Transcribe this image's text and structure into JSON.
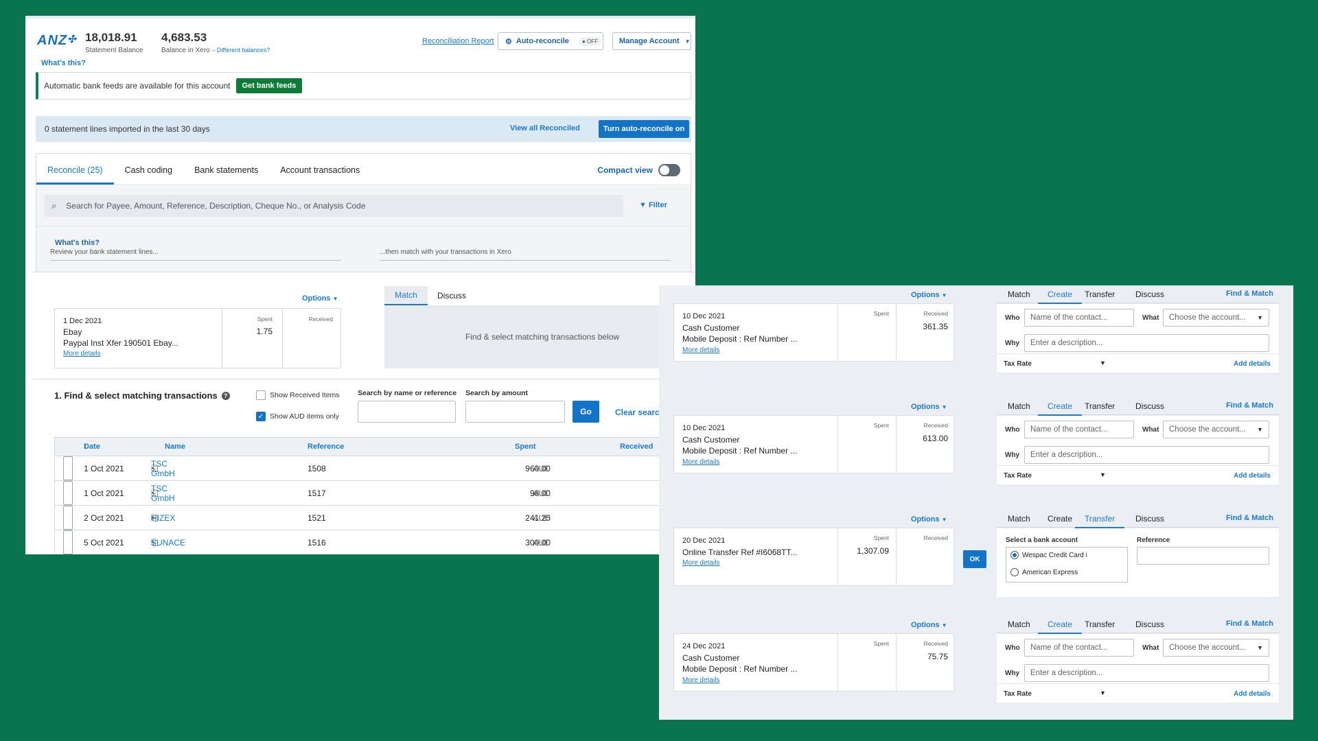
{
  "header": {
    "bank_logo": "ANZ",
    "statement_balance": "18,018.91",
    "statement_balance_label": "Statement Balance",
    "xero_balance": "4,683.53",
    "xero_balance_label": "Balance in Xero",
    "different_balances": "– Different balances?",
    "whats_this": "What's this?",
    "reconciliation_report": "Reconciliation Report",
    "auto_reconcile": "Auto-reconcile",
    "auto_reconcile_state": "OFF",
    "manage_account": "Manage Account"
  },
  "feeds_banner": {
    "text": "Automatic bank feeds are available for this account",
    "button": "Get bank feeds"
  },
  "statement_bar": {
    "text": "0 statement lines imported in the last 30 days",
    "view_all": "View all Reconciled",
    "turn_on": "Turn auto-reconcile on"
  },
  "tabs": [
    "Reconcile (25)",
    "Cash coding",
    "Bank statements",
    "Account transactions"
  ],
  "compact_view": "Compact view",
  "search": {
    "placeholder": "Search for Payee, Amount, Reference, Description, Cheque No., or Analysis Code",
    "filter": "Filter"
  },
  "help": {
    "title": "What's this?",
    "left": "Review your bank statement lines...",
    "right": "...then match with your transactions in Xero"
  },
  "left_tx": {
    "options": "Options",
    "date": "1 Dec 2021",
    "payee": "Ebay",
    "description": "Paypal Inst Xfer 190501 Ebay...",
    "more": "More details",
    "spent_label": "Spent",
    "spent": "1.75",
    "received_label": "Received",
    "match_tab": "Match",
    "discuss_tab": "Discuss",
    "match_hint": "Find & select matching transactions below"
  },
  "find": {
    "title": "1. Find & select matching transactions",
    "show_received": "Show Received Items",
    "show_aud": "Show AUD items only",
    "search_name_label": "Search by name or reference",
    "search_amount_label": "Search by amount",
    "go": "Go",
    "clear": "Clear search"
  },
  "table": {
    "columns": [
      "Date",
      "Name",
      "Reference",
      "Spent",
      "Received"
    ],
    "rows": [
      {
        "date": "1 Oct 2021",
        "name": "TSC GmbH",
        "reference": "1508",
        "spent": "960.00",
        "currency": "AUD"
      },
      {
        "date": "1 Oct 2021",
        "name": "TSC GmbH",
        "reference": "1517",
        "spent": "98.00",
        "currency": "AUD"
      },
      {
        "date": "2 Oct 2021",
        "name": "HIZEX",
        "reference": "1521",
        "spent": "241.25",
        "currency": "AUD"
      },
      {
        "date": "5 Oct 2021",
        "name": "SUNACE",
        "reference": "1516",
        "spent": "300.00",
        "currency": "AUD"
      }
    ]
  },
  "right": {
    "options": "Options",
    "tabs": [
      "Match",
      "Create",
      "Transfer",
      "Discuss"
    ],
    "find_match": "Find & Match",
    "who": "Who",
    "what": "What",
    "why": "Why",
    "who_placeholder": "Name of the contact...",
    "what_placeholder": "Choose the account...",
    "why_placeholder": "Enter a description...",
    "tax_rate": "Tax Rate",
    "add_details": "Add details",
    "spent_label": "Spent",
    "received_label": "Received",
    "more": "More details",
    "ok": "OK",
    "select_bank": "Select a bank account",
    "reference": "Reference",
    "accounts": [
      "Wespac Credit Card i",
      "American Express"
    ],
    "items": [
      {
        "date": "10 Dec 2021",
        "payee": "Cash Customer",
        "description": "Mobile Deposit : Ref Number ...",
        "spent": "",
        "received": "361.35"
      },
      {
        "date": "10 Dec 2021",
        "payee": "Cash Customer",
        "description": "Mobile Deposit : Ref Number ...",
        "spent": "",
        "received": "613.00"
      },
      {
        "date": "20 Dec 2021",
        "payee": "Online Transfer Ref #I6068TT...",
        "description": "",
        "spent": "1,307.09",
        "received": ""
      },
      {
        "date": "24 Dec 2021",
        "payee": "Cash Customer",
        "description": "Mobile Deposit : Ref Number ...",
        "spent": "",
        "received": "75.75"
      }
    ]
  },
  "colors": {
    "background": "#0a734f",
    "accent": "#1373c6",
    "feeds_button": "#0e7c38"
  }
}
